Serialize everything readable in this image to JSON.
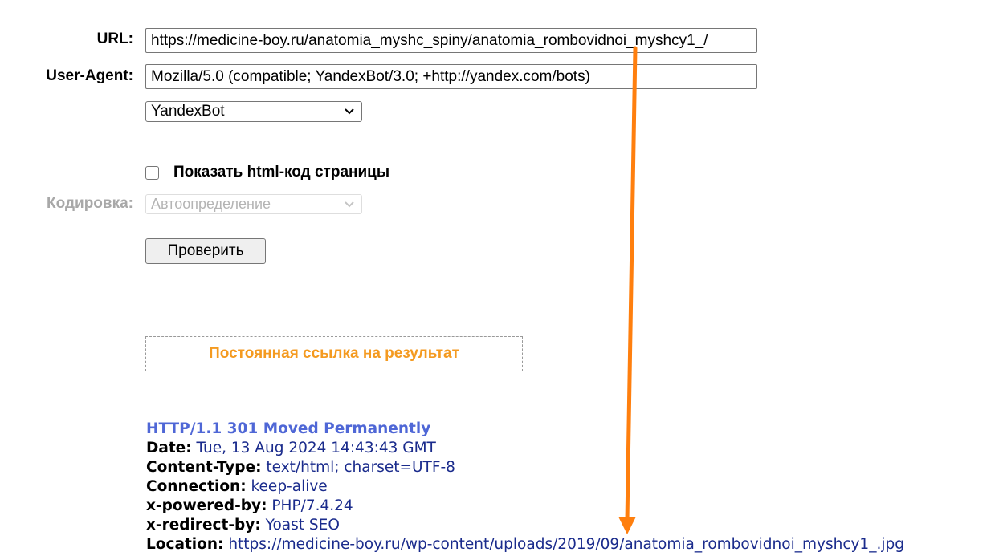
{
  "form": {
    "url_label": "URL:",
    "url_value": "https://medicine-boy.ru/anatomia_myshc_spiny/anatomia_rombovidnoi_myshcy1_/",
    "ua_label": "User-Agent:",
    "ua_value": "Mozilla/5.0 (compatible; YandexBot/3.0; +http://yandex.com/bots)",
    "bot_select_value": "YandexBot",
    "show_html_label": "Показать html-код страницы",
    "show_html_checked": false,
    "encoding_label": "Кодировка:",
    "encoding_value": "Автоопределение",
    "submit_label": "Проверить"
  },
  "permalink": {
    "text": "Постоянная ссылка на результат"
  },
  "response": {
    "status_line": "HTTP/1.1 301 Moved Permanently",
    "headers": [
      {
        "key": "Date:",
        "value": "Tue, 13 Aug 2024 14:43:43 GMT"
      },
      {
        "key": "Content-Type:",
        "value": "text/html; charset=UTF-8"
      },
      {
        "key": "Connection:",
        "value": "keep-alive"
      },
      {
        "key": "x-powered-by:",
        "value": "PHP/7.4.24"
      },
      {
        "key": "x-redirect-by:",
        "value": "Yoast SEO"
      },
      {
        "key": "Location:",
        "value": "https://medicine-boy.ru/wp-content/uploads/2019/09/anatomia_rombovidnoi_myshcy1_.jpg"
      }
    ]
  },
  "colors": {
    "permalink": "#f49a20",
    "status_line": "#4f67d6",
    "header_value": "#1a2b8c",
    "annotation_arrow": "#ff7f0e"
  },
  "icons": {
    "select_chevron": "chevron-down-icon",
    "annotation": "arrow-down-icon"
  }
}
